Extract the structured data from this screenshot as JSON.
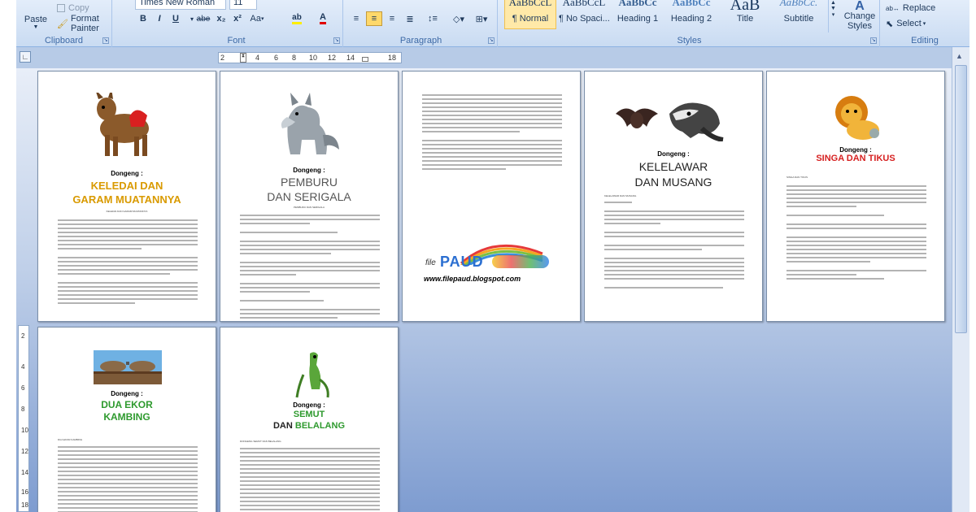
{
  "ribbon": {
    "clipboard": {
      "label": "Clipboard",
      "paste": "Paste",
      "copy": "Copy",
      "format_painter": "Format Painter"
    },
    "font": {
      "label": "Font",
      "font_name": "Times New Roman",
      "font_size": "11",
      "bold": "B",
      "italic": "I",
      "underline": "U",
      "strike": "abe",
      "subscript": "x₂",
      "superscript": "x²",
      "change_case": "Aa"
    },
    "paragraph": {
      "label": "Paragraph"
    },
    "styles": {
      "label": "Styles",
      "items": [
        {
          "preview": "AaBbCcL",
          "name": "¶ Normal"
        },
        {
          "preview": "AaBbCcL",
          "name": "¶ No Spaci..."
        },
        {
          "preview": "AaBbCc",
          "name": "Heading 1"
        },
        {
          "preview": "AaBbCc",
          "name": "Heading 2"
        },
        {
          "preview": "AaB",
          "name": "Title"
        },
        {
          "preview": "AaBbCc.",
          "name": "Subtitle"
        }
      ],
      "change_styles": "Change Styles"
    },
    "editing": {
      "label": "Editing",
      "replace": "Replace",
      "select": "Select"
    }
  },
  "ruler": {
    "ticks": [
      "2",
      "2",
      "4",
      "6",
      "8",
      "10",
      "12",
      "14",
      "16",
      "18"
    ],
    "vticks": [
      "2",
      "2",
      "4",
      "6",
      "8",
      "10",
      "12",
      "14",
      "16",
      "18"
    ]
  },
  "pages": [
    {
      "prefix": "Dongeng :",
      "title_line1": "KELEDAI DAN",
      "title_line2": "GARAM MUATANNYA",
      "subtitle": "KELEDAI DAN GARAM MUATANNYA"
    },
    {
      "prefix": "Dongeng :",
      "title_line1": "PEMBURU",
      "title_line2": "DAN SERIGALA",
      "subtitle": "PEMBURU DAN SERIGALA"
    },
    {
      "logo_text": "PAUD",
      "logo_prefix": "file",
      "url": "www.filepaud.blogspot.com"
    },
    {
      "prefix": "Dongeng :",
      "title_line1": "KELELAWAR",
      "title_line2": "DAN MUSANG",
      "subtitle": "KELELAWAR DAN MUSANG"
    },
    {
      "prefix": "Dongeng :",
      "title_line1": "SINGA DAN TIKUS",
      "subtitle": "SINGA DAN TIKUS"
    },
    {
      "prefix": "Dongeng :",
      "title_line1": "DUA EKOR",
      "title_line2": "KAMBING",
      "subtitle": "DUA EKOR KAMBING"
    },
    {
      "prefix": "Dongeng :",
      "title_line1": "SEMUT",
      "title_join": "DAN",
      "title_line2": "BELALANG",
      "subtitle": "DONGENG SEMUT DAN BELALANG"
    }
  ],
  "colors": {
    "keledai_title": "#d99a00",
    "pemburu_title": "#555555",
    "singa_title": "#d62020",
    "kambing_title": "#2e9a2e",
    "semut_title": "#2e9a2e"
  }
}
